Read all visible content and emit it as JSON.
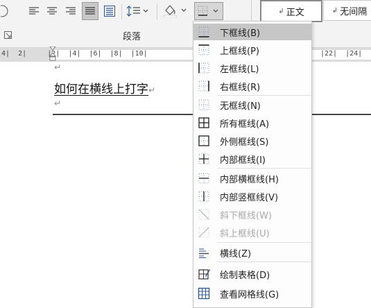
{
  "ribbon": {
    "group_label": "段落",
    "styles": [
      {
        "mark": "↲",
        "label": "正文"
      },
      {
        "mark": "↲",
        "label": "无间隔"
      }
    ]
  },
  "ruler": {
    "text": "4|  2|     |2|  |4|  |6|  |8|  |10|"
  },
  "ruler_right": {
    "text": "|22|  |24|"
  },
  "document": {
    "heading": "如何在横线上打字",
    "para_mark": "↵"
  },
  "border_menu": {
    "items": [
      {
        "label": "下框线(B)",
        "icon": "bottom-border-icon"
      },
      {
        "label": "上框线(P)",
        "icon": "top-border-icon"
      },
      {
        "label": "左框线(L)",
        "icon": "left-border-icon"
      },
      {
        "label": "右框线(R)",
        "icon": "right-border-icon"
      },
      {
        "label": "无框线(N)",
        "icon": "no-border-icon"
      },
      {
        "label": "所有框线(A)",
        "icon": "all-borders-icon"
      },
      {
        "label": "外侧框线(S)",
        "icon": "outside-borders-icon"
      },
      {
        "label": "内部框线(I)",
        "icon": "inside-borders-icon"
      },
      {
        "label": "内部横框线(H)",
        "icon": "inside-horizontal-border-icon"
      },
      {
        "label": "内部竖框线(V)",
        "icon": "inside-vertical-border-icon"
      },
      {
        "label": "斜下框线(W)",
        "icon": "diagonal-down-border-icon"
      },
      {
        "label": "斜上框线(U)",
        "icon": "diagonal-up-border-icon"
      },
      {
        "label": "横线(Z)",
        "icon": "horizontal-line-icon"
      },
      {
        "label": "绘制表格(D)",
        "icon": "draw-table-icon"
      },
      {
        "label": "查看网格线(G)",
        "icon": "view-gridlines-icon"
      }
    ]
  }
}
